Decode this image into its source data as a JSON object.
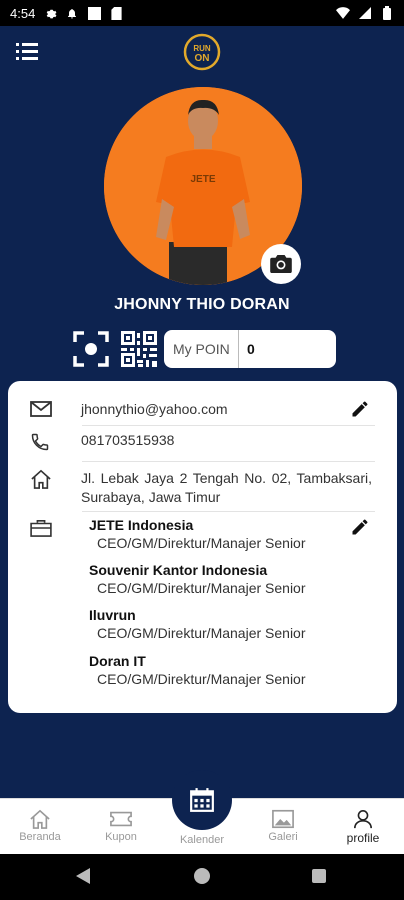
{
  "status_bar": {
    "time": "4:54"
  },
  "profile": {
    "name": "JHONNY THIO DORAN",
    "poin_label": "My POIN",
    "poin_value": "0",
    "shirt_text": "JETE"
  },
  "contact": {
    "email": "jhonnythio@yahoo.com",
    "phone": "081703515938",
    "address": "Jl. Lebak Jaya 2 Tengah No. 02, Tambaksari, Surabaya, Jawa Timur"
  },
  "companies": [
    {
      "name": "JETE Indonesia",
      "role": "CEO/GM/Direktur/Manajer Senior"
    },
    {
      "name": "Souvenir Kantor Indonesia",
      "role": "CEO/GM/Direktur/Manajer Senior"
    },
    {
      "name": "Iluvrun",
      "role": "CEO/GM/Direktur/Manajer Senior"
    },
    {
      "name": "Doran IT",
      "role": "CEO/GM/Direktur/Manajer Senior"
    }
  ],
  "nav": {
    "beranda": "Beranda",
    "kupon": "Kupon",
    "kalender": "Kalender",
    "galeri": "Galeri",
    "profile": "profile"
  },
  "colors": {
    "primary": "#0d2350",
    "accent": "#f57c1f",
    "logo": "#e2a92b"
  }
}
